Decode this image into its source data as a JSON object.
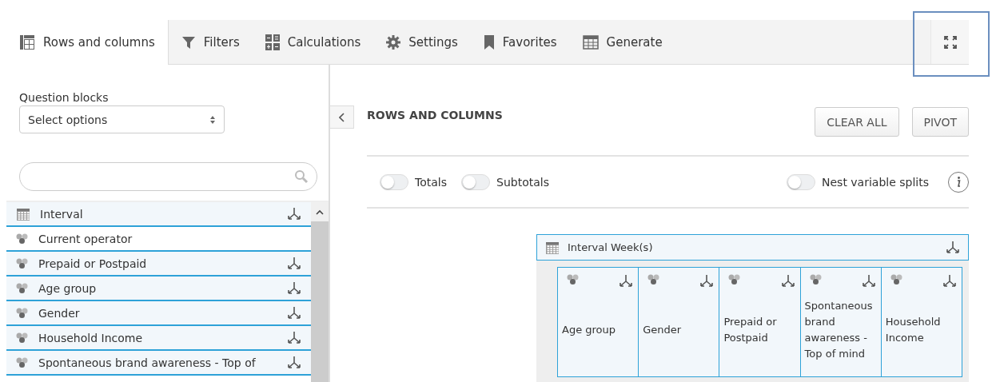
{
  "tabs": [
    {
      "label": "Rows and columns",
      "kind": "grid",
      "selected": true
    },
    {
      "label": "Filters",
      "kind": "filter",
      "selected": false
    },
    {
      "label": "Calculations",
      "kind": "calc",
      "selected": false
    },
    {
      "label": "Settings",
      "kind": "gear",
      "selected": false
    },
    {
      "label": "Favorites",
      "kind": "bookmark",
      "selected": false
    },
    {
      "label": "Generate",
      "kind": "table",
      "selected": false
    }
  ],
  "expand_button": {
    "highlighted": true
  },
  "sidebar": {
    "question_blocks": {
      "label": "Question blocks",
      "value": "Select options"
    },
    "items": [
      {
        "label": "Interval",
        "kind": "date",
        "splittable": true
      },
      {
        "label": "Current operator",
        "kind": "category",
        "splittable": false
      },
      {
        "label": "Prepaid or Postpaid",
        "kind": "category",
        "splittable": true
      },
      {
        "label": "Age group",
        "kind": "category",
        "splittable": true
      },
      {
        "label": "Gender",
        "kind": "category",
        "splittable": true
      },
      {
        "label": "Household Income",
        "kind": "category",
        "splittable": true
      },
      {
        "label": "Spontaneous brand awareness - Top of",
        "kind": "category",
        "splittable": true
      }
    ]
  },
  "main": {
    "title": "ROWS AND COLUMNS",
    "buttons": [
      "CLEAR ALL",
      "PIVOT"
    ],
    "toggles": [
      {
        "label": "Totals",
        "on": false
      },
      {
        "label": "Subtotals",
        "on": false
      },
      {
        "label": "Nest variable splits",
        "on": false
      }
    ],
    "row_variable": {
      "label": "Interval Week(s)",
      "kind": "date"
    },
    "column_variables": [
      {
        "label": "Age group",
        "kind": "category"
      },
      {
        "label": "Gender",
        "kind": "category"
      },
      {
        "label": "Prepaid or Postpaid",
        "kind": "category"
      },
      {
        "label": "Spontaneous brand awareness - Top of mind",
        "kind": "category"
      },
      {
        "label": "Household Income",
        "kind": "category"
      }
    ]
  }
}
